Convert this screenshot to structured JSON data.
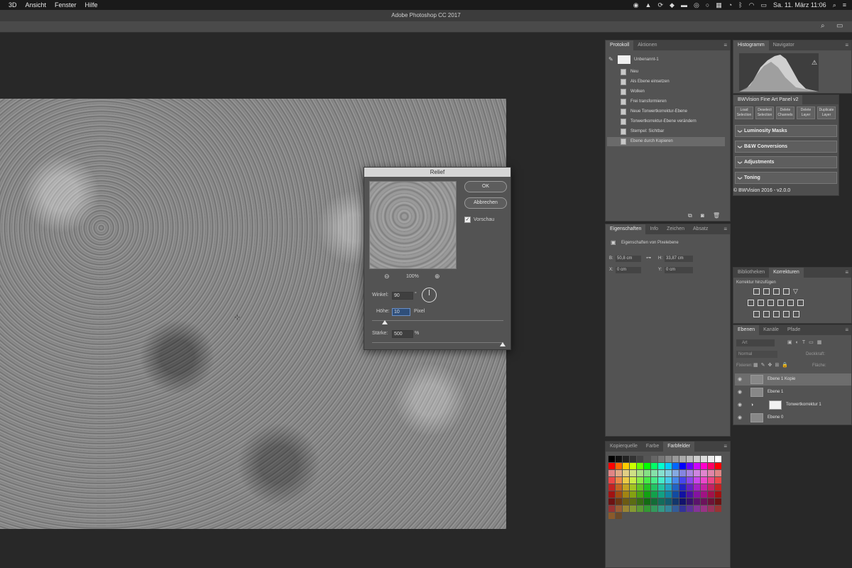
{
  "menubar": {
    "items": [
      "3D",
      "Ansicht",
      "Fenster",
      "Hilfe"
    ],
    "datetime": "Sa. 11. März 11:06"
  },
  "titlebar": {
    "title": "Adobe Photoshop CC 2017"
  },
  "dialog": {
    "title": "Relief",
    "ok": "OK",
    "cancel": "Abbrechen",
    "preview_label": "Vorschau",
    "preview_checked": true,
    "zoom": "100%",
    "angle_label": "Winkel:",
    "angle_value": "90",
    "angle_unit": "°",
    "height_label": "Höhe:",
    "height_value": "10",
    "height_unit": "Pixel",
    "amount_label": "Stärke:",
    "amount_value": "500",
    "amount_unit": "%"
  },
  "history_panel": {
    "tabs": [
      "Protokoll",
      "Aktionen"
    ],
    "snapshot": "Unbenannt-1",
    "items": [
      "Neu",
      "Als Ebene einsetzen",
      "Wolken",
      "Frei transformieren",
      "Neue Tonwertkorrektur-Ebene",
      "Tonwertkorrektur-Ebene verändern",
      "Stempel: Sichtbar",
      "Ebene durch Kopieren"
    ],
    "selected_index": 7
  },
  "histogram_panel": {
    "tabs": [
      "Histogramm",
      "Navigator"
    ]
  },
  "bwvision_panel": {
    "title": "BWVision Fine Art Panel v2",
    "buttons": [
      "Load Selection",
      "Deselect Selection",
      "Delete Channels",
      "Delete Layer",
      "Duplicate Layer"
    ],
    "sections": [
      "Luminosity Masks",
      "B&W Conversions",
      "Adjustments",
      "Toning"
    ],
    "footer": "© BWVision 2016 - v2.0.0"
  },
  "properties_panel": {
    "tabs": [
      "Eigenschaften",
      "Info",
      "Zeichen",
      "Absatz"
    ],
    "header": "Eigenschaften von Pixelebene",
    "w_label": "B:",
    "w_value": "50,8 cm",
    "h_label": "H:",
    "h_value": "33,87 cm",
    "x_label": "X:",
    "x_value": "0 cm",
    "y_label": "Y:",
    "y_value": "0 cm"
  },
  "adjustments_panel": {
    "tabs": [
      "Bibliotheken",
      "Korrekturen"
    ],
    "header": "Korrektur hinzufügen"
  },
  "layers_panel": {
    "tabs": [
      "Ebenen",
      "Kanäle",
      "Pfade"
    ],
    "search_placeholder": "Art",
    "blend_mode": "Normal",
    "opacity_label": "Deckkraft:",
    "lock_label": "Fixieren:",
    "fill_label": "Fläche:",
    "layers": [
      "Ebene 1 Kopie",
      "Ebene 1",
      "Tonwertkorrektur 1",
      "Ebene 0"
    ],
    "selected_index": 0
  },
  "swatches_panel": {
    "tabs": [
      "Kopierquelle",
      "Farbe",
      "Farbfelder"
    ]
  }
}
